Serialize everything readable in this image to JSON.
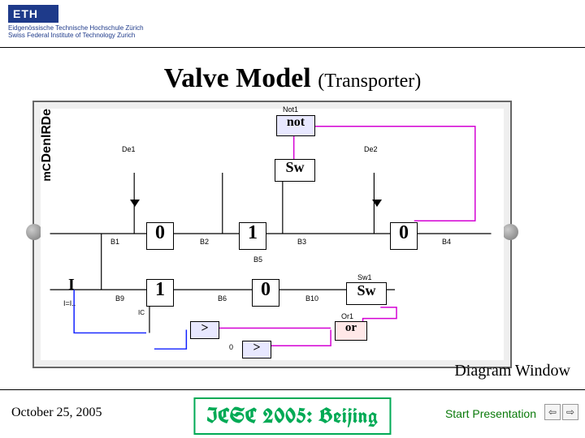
{
  "header": {
    "logo": "ETH",
    "institution_line1": "Eidgenössische Technische Hochschule Zürich",
    "institution_line2": "Swiss Federal Institute of Technology Zurich"
  },
  "title": {
    "main": "Valve Model",
    "sub": "(Transporter)"
  },
  "diagram": {
    "caption": "Diagram Window",
    "blocks": {
      "not": "not",
      "or": "or",
      "gt1": ">",
      "gt2": ">",
      "sw_top": "Sw",
      "sw_bot": "Sw"
    },
    "nodes": {
      "z1": "0",
      "z2": "1",
      "z3": "0",
      "z4": "1",
      "z5": "0"
    },
    "labels": {
      "de1": "De",
      "de2": "De",
      "nlr": "nlR",
      "b1": "B1",
      "b2": "B2",
      "b3": "B3",
      "b4": "B4",
      "b5": "B5",
      "b6": "B6",
      "b9": "B9",
      "b10": "B10",
      "de1b": "De1",
      "de2b": "De2",
      "sw1": "Sw1",
      "or1": "Or1",
      "not1": "Not1",
      "zero": "0",
      "one": "1",
      "mc": "mC",
      "mc_ic": "IC",
      "i": "I",
      "il": "I=I.."
    }
  },
  "footer": {
    "date": "October 25, 2005",
    "conference": "ICSC 2005: Beijing",
    "start_presentation": "Start Presentation",
    "nav_prev": "⇦",
    "nav_next": "⇨"
  },
  "colors": {
    "magenta": "#d400d4",
    "blue": "#1020ff",
    "green": "#0a7a0a"
  }
}
